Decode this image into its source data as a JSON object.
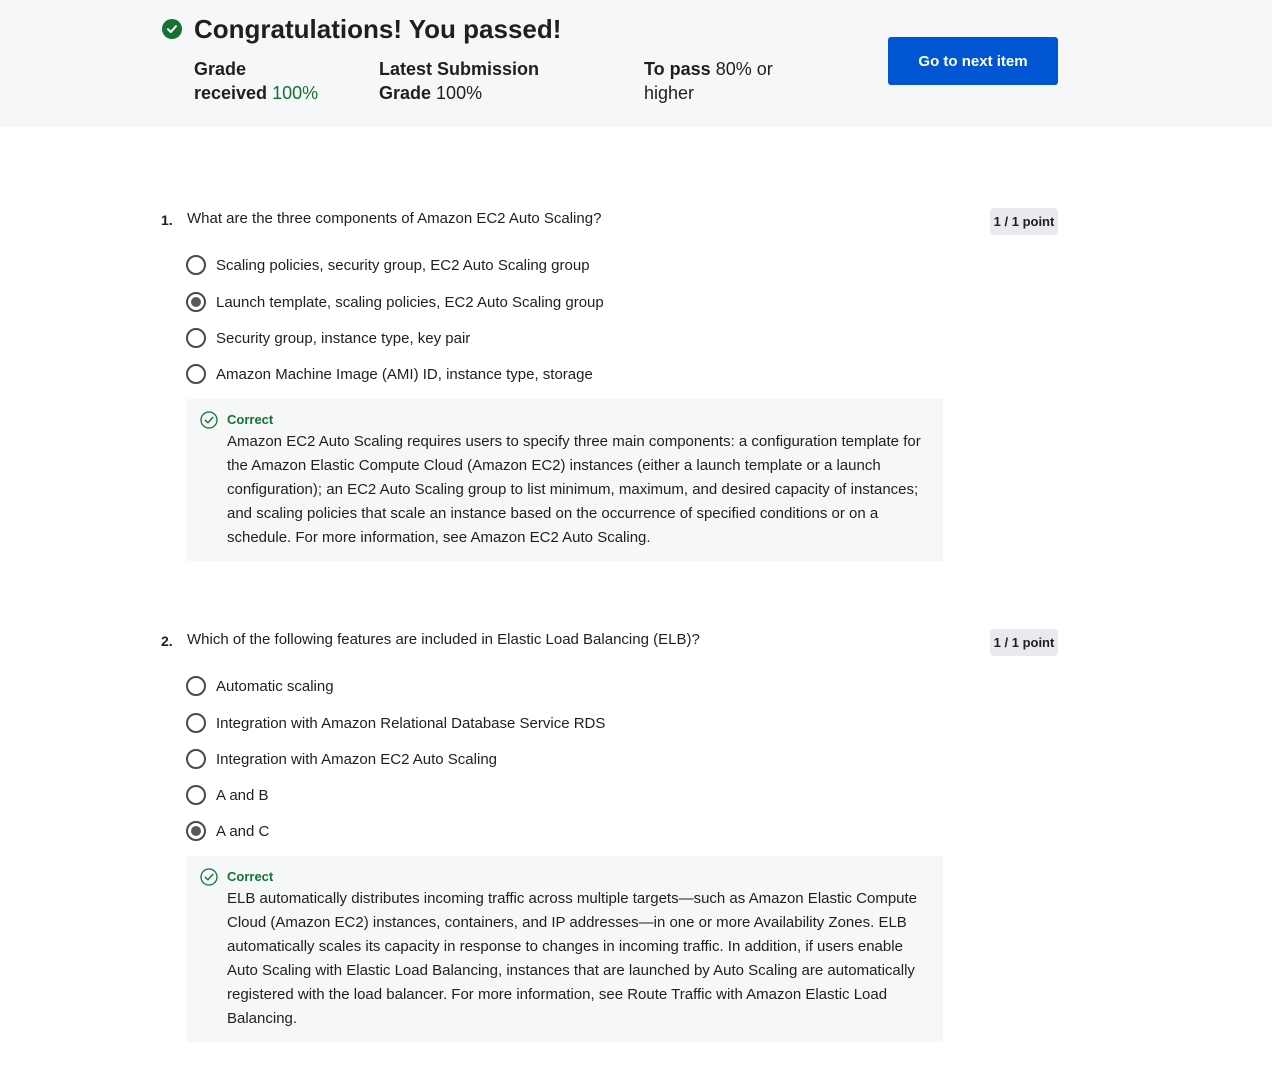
{
  "header": {
    "title": "Congratulations! You passed!",
    "grade_received_label_1": "Grade",
    "grade_received_label_2": "received",
    "grade_received_value": "100%",
    "latest_label_1": "Latest Submission",
    "latest_label_2": "Grade",
    "latest_value": "100%",
    "to_pass_label": "To pass",
    "to_pass_value_1": "80% or",
    "to_pass_value_2": "higher",
    "next_button": "Go to next item"
  },
  "questions": [
    {
      "number": "1.",
      "text": "What are the three components of Amazon EC2 Auto Scaling?",
      "points": "1 / 1 point",
      "options": [
        {
          "label": "Scaling policies, security group, EC2 Auto Scaling group",
          "selected": false
        },
        {
          "label": "Launch template, scaling policies, EC2 Auto Scaling group",
          "selected": true
        },
        {
          "label": "Security group, instance type, key pair",
          "selected": false
        },
        {
          "label": "Amazon Machine Image (AMI) ID, instance type, storage",
          "selected": false
        }
      ],
      "feedback_label": "Correct",
      "feedback_text": "Amazon EC2 Auto Scaling requires users to specify three main components: a configuration template for the Amazon Elastic Compute Cloud (Amazon EC2) instances (either a launch template or a launch configuration); an EC2 Auto Scaling group to list minimum, maximum, and desired capacity of instances; and scaling policies that scale an instance based on the occurrence of specified conditions or on a schedule. For more information, see Amazon EC2 Auto Scaling."
    },
    {
      "number": "2.",
      "text": "Which of the following features are included in Elastic Load Balancing (ELB)?",
      "points": "1 / 1 point",
      "options": [
        {
          "label": "Automatic scaling",
          "selected": false
        },
        {
          "label": "Integration with Amazon Relational Database Service RDS",
          "selected": false
        },
        {
          "label": "Integration with Amazon EC2 Auto Scaling",
          "selected": false
        },
        {
          "label": "A and B",
          "selected": false
        },
        {
          "label": "A and C",
          "selected": true
        }
      ],
      "feedback_label": "Correct",
      "feedback_text": "ELB automatically distributes incoming traffic across multiple targets—such as Amazon Elastic Compute Cloud (Amazon EC2) instances, containers, and IP addresses—in one or more Availability Zones. ELB automatically scales its capacity in response to changes in incoming traffic. In addition, if users enable Auto Scaling with Elastic Load Balancing, instances that are launched by Auto Scaling are automatically registered with the load balancer. For more information, see Route Traffic with Amazon Elastic Load Balancing."
    }
  ],
  "colors": {
    "accent": "#0056d2",
    "success": "#137333",
    "panel": "#f5f7f8"
  }
}
